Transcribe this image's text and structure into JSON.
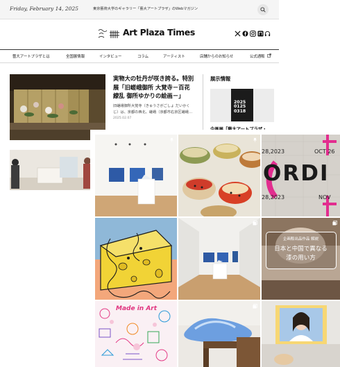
{
  "header": {
    "date": "Friday, February 14, 2025",
    "tagline": "東京藝術大学のギャラリー「藝大アートプラザ」のWebマガジン",
    "brand": "Art Plaza Times"
  },
  "nav": {
    "items": [
      "藝大アートプラザとは",
      "全国展情報",
      "インタビュー",
      "コラム",
      "アーティスト",
      "店舗からのお知らせ",
      "公式通販"
    ]
  },
  "article": {
    "title": "実物大の牡丹が咲き誇る。特別展「旧嵯峨御所 大覚寺－百花繚乱 御所ゆかりの絵画－」",
    "excerpt": "旧嵯峨御所大覚寺（きゅうさがごしょ だいかくじ）は、京都の西北、嵯峨（京都市右京区嵯峨…",
    "date": "2025.02.07"
  },
  "sidebar": {
    "heading": "展示情報",
    "book_lines": [
      "2025",
      "0125",
      "0318"
    ],
    "card_title": "企画展「藝大アートプラザ・"
  },
  "gallery": {
    "tile3_left_top": "28,2023",
    "tile3_right_top": "OCT 26",
    "tile3_word": "ORDI",
    "tile3_left_bottom": "28,2023",
    "tile3_right_bottom": "NOV",
    "tile6_caption": "企画販出品作品 解説",
    "tile6_line1": "日本と中国で異なる",
    "tile6_line2": "漆の用い方",
    "tile7_title": "Made in Art"
  },
  "colors": {
    "nav_border": "#333333",
    "topbar_bg": "#f5f5f5",
    "accent_pink": "#e22d8f",
    "cheese_yellow": "#f1d336"
  }
}
